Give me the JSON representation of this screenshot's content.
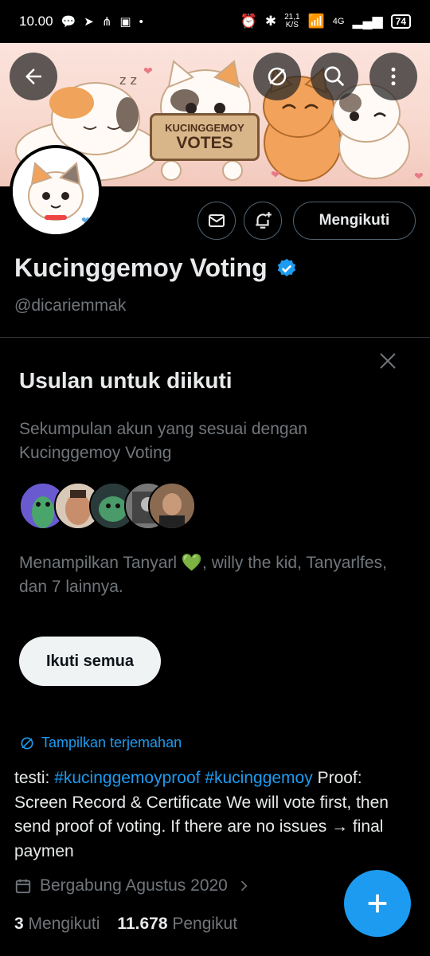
{
  "status_bar": {
    "time": "10.00",
    "net_speed_value": "21,1",
    "net_speed_unit": "K/S",
    "network": "4G",
    "battery": "74"
  },
  "banner": {
    "sign_line1": "KUCINGGEMOY",
    "sign_line2": "VOTES"
  },
  "profile": {
    "display_name": "Kucinggemoy Voting",
    "handle": "@dicariemmak",
    "follow_state_label": "Mengikuti"
  },
  "suggestions": {
    "title": "Usulan untuk diikuti",
    "description": "Sekumpulan akun yang sesuai dengan Kucinggemoy Voting",
    "showing_text": "Menampilkan Tanyarl 💚, willy the kid, Tanyarlfes, dan 7 lainnya.",
    "follow_all_label": "Ikuti semua"
  },
  "bio": {
    "translate_label": "Tampilkan terjemahan",
    "prefix": "testi: ",
    "hashtag1": "#kucinggemoyproof",
    "space": " ",
    "hashtag2": "#kucinggemoy",
    "text": " Proof: Screen Record & Certificate We will vote first, then send proof of voting. If there are no issues → final paymen"
  },
  "joined": "Bergabung Agustus 2020",
  "counts": {
    "following_value": "3",
    "following_label": "Mengikuti",
    "followers_value": "11.678",
    "followers_label": "Pengikut"
  },
  "colors": {
    "accent": "#1d9bf0",
    "background": "#000000",
    "muted": "#71767b"
  },
  "icons": [
    "back-arrow-icon",
    "translate-icon",
    "search-icon",
    "more-vertical-icon",
    "mail-icon",
    "bell-plus-icon",
    "verified-badge-icon",
    "close-icon",
    "calendar-icon",
    "chevron-right-icon",
    "plus-icon"
  ]
}
